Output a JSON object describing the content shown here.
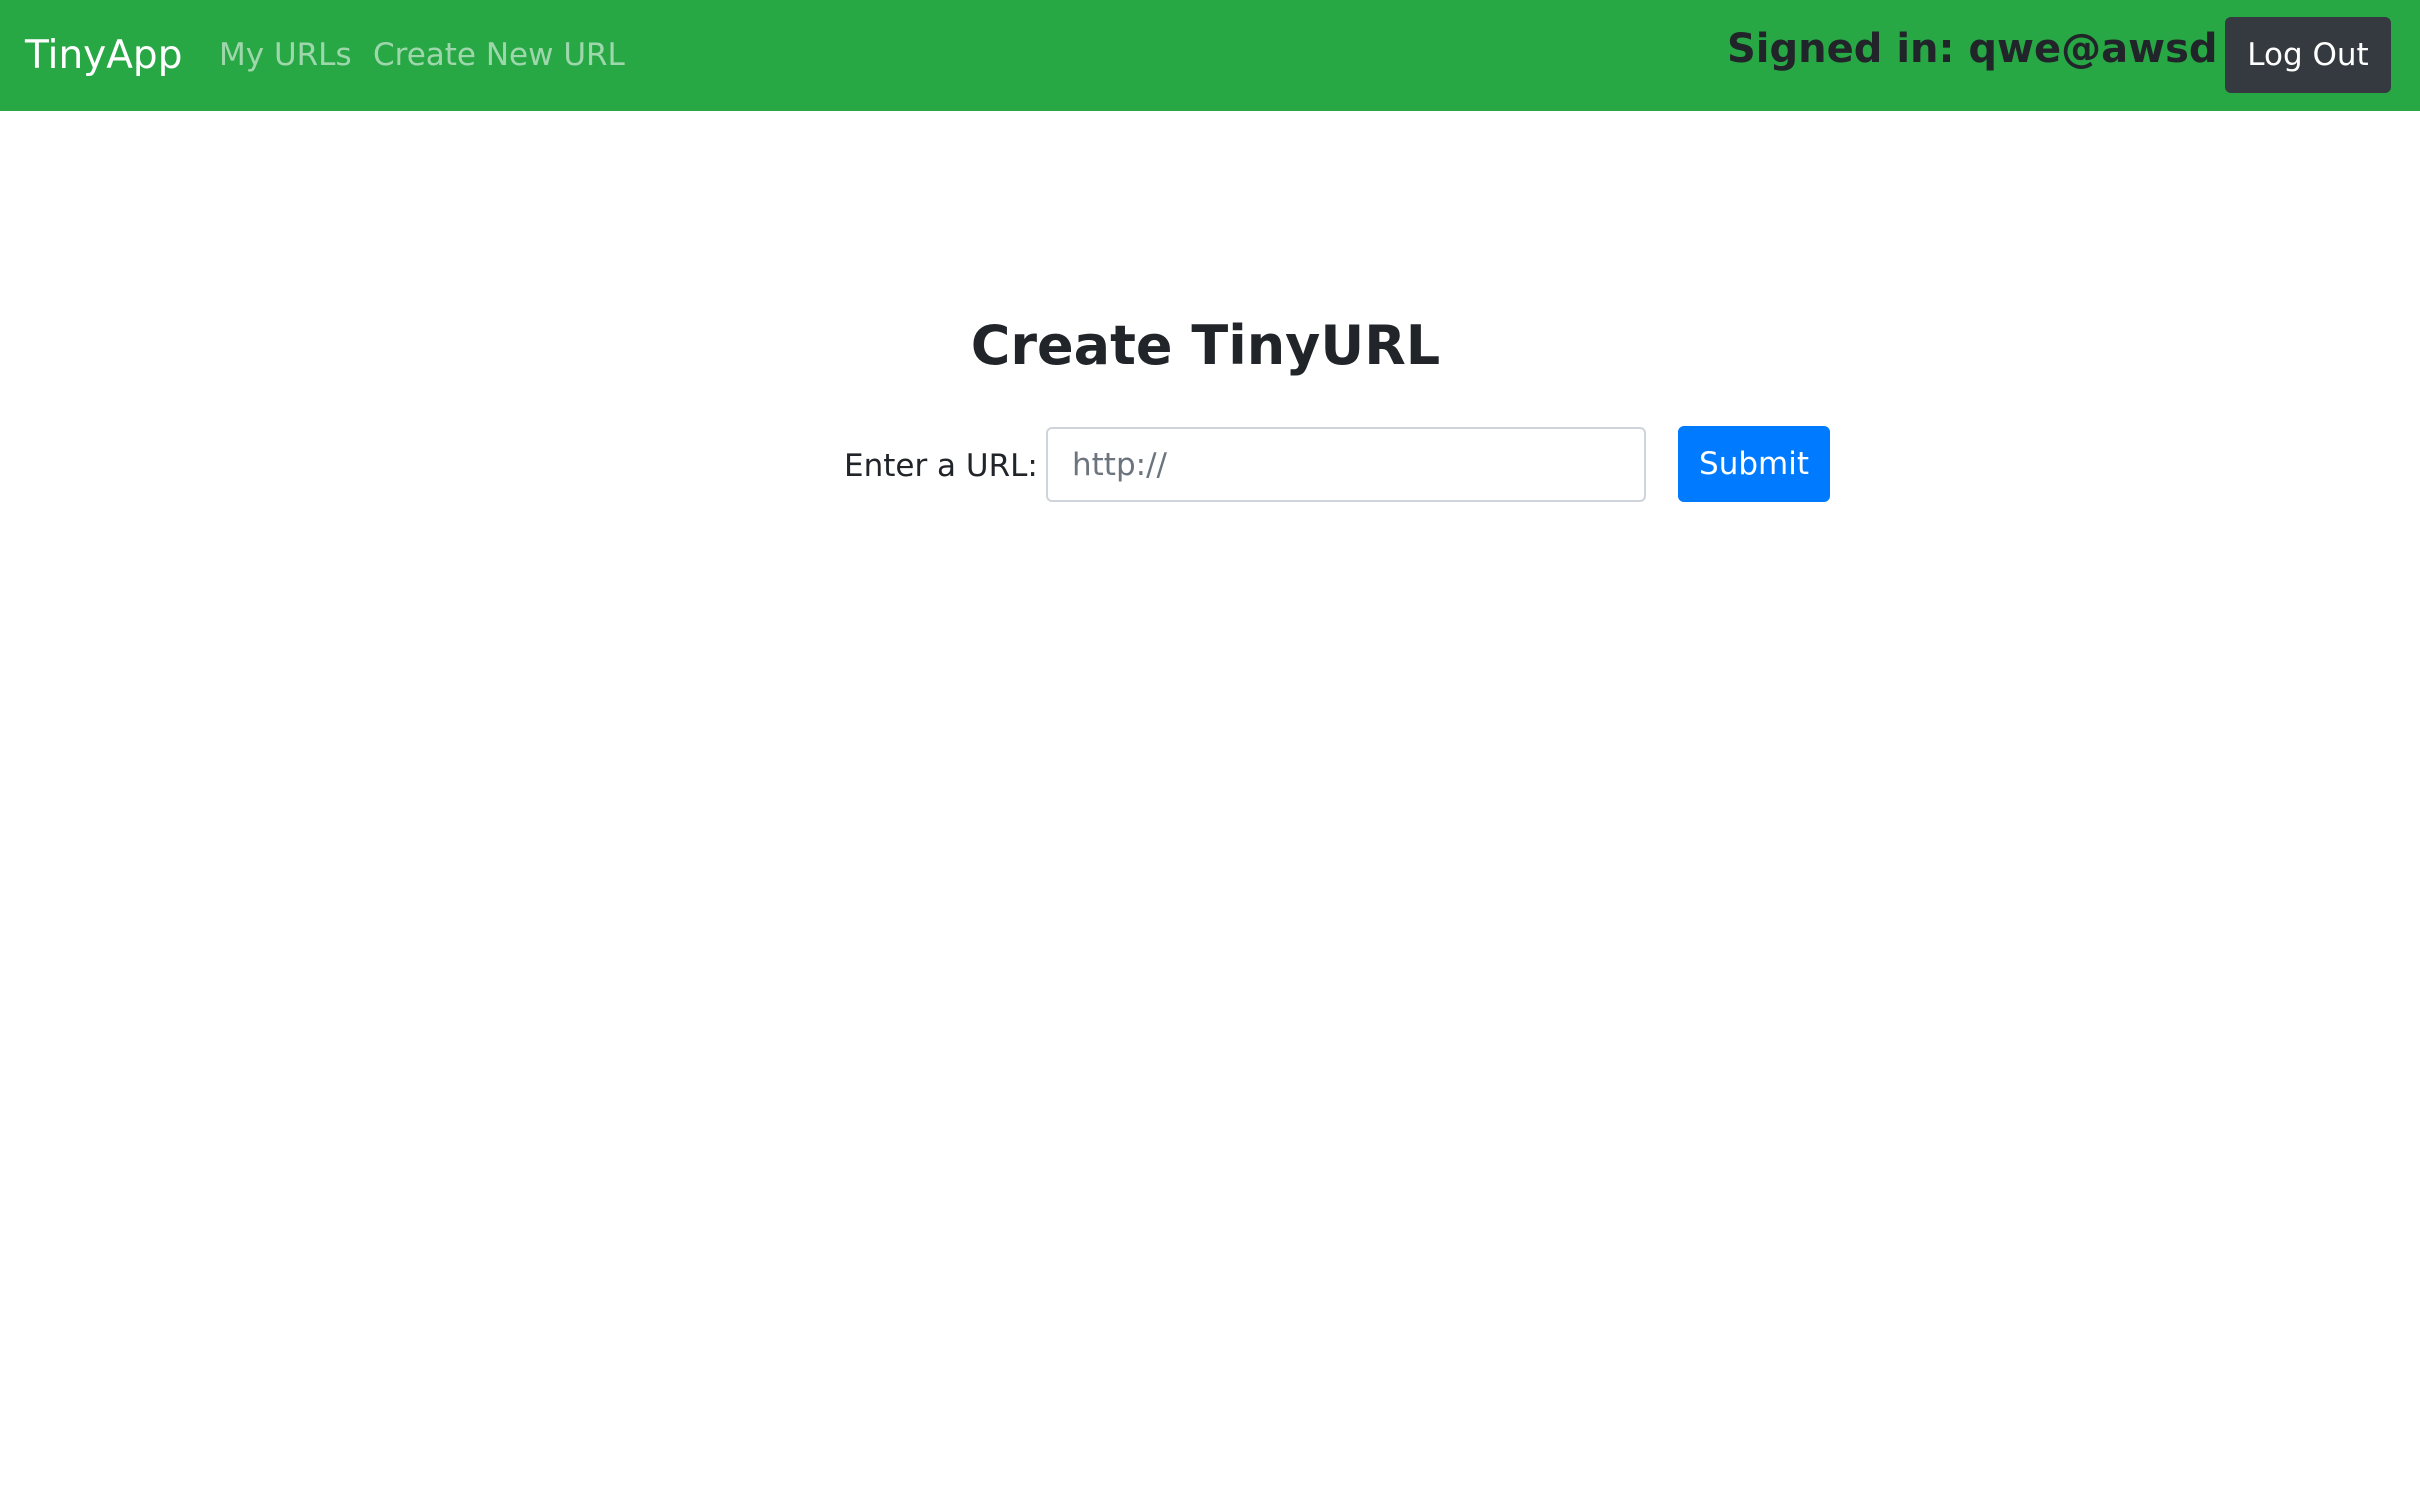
{
  "navbar": {
    "brand": "TinyApp",
    "links": [
      {
        "label": "My URLs"
      },
      {
        "label": "Create New URL"
      }
    ],
    "signed_in_text": "Signed in: qwe@awsd",
    "logout_label": "Log Out"
  },
  "main": {
    "title": "Create TinyURL",
    "form": {
      "label": "Enter a URL:",
      "input_value": "",
      "input_placeholder": "http://",
      "submit_label": "Submit"
    }
  },
  "colors": {
    "navbar_bg": "#28a745",
    "logout_bg": "#343a40",
    "submit_bg": "#007bff"
  }
}
